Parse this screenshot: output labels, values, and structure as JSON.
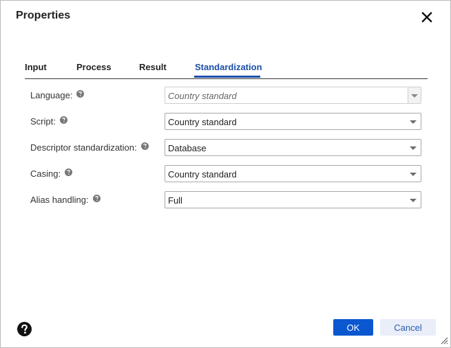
{
  "dialog": {
    "title": "Properties"
  },
  "tabs": [
    {
      "label": "Input",
      "active": false
    },
    {
      "label": "Process",
      "active": false
    },
    {
      "label": "Result",
      "active": false
    },
    {
      "label": "Standardization",
      "active": true
    }
  ],
  "fields": [
    {
      "label": "Language:",
      "value": "Country standard",
      "disabled": true
    },
    {
      "label": "Script:",
      "value": "Country standard",
      "disabled": false
    },
    {
      "label": "Descriptor standardization:",
      "value": "Database",
      "disabled": false
    },
    {
      "label": "Casing:",
      "value": "Country standard",
      "disabled": false
    },
    {
      "label": "Alias handling:",
      "value": "Full",
      "disabled": false
    }
  ],
  "footer": {
    "ok_label": "OK",
    "cancel_label": "Cancel"
  },
  "colors": {
    "accent": "#1a4ea8",
    "primary_button": "#0b57d0",
    "secondary_button_bg": "#e9eef8"
  },
  "icons": {
    "close": "close-icon",
    "help": "help-icon",
    "dropdown": "chevron-down-icon",
    "resize": "resize-grip-icon"
  }
}
